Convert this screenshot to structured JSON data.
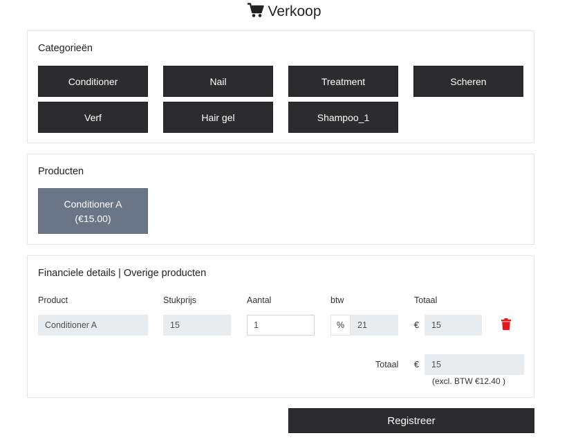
{
  "page": {
    "title": "Verkoop",
    "icon": "shopping-cart-icon"
  },
  "categories": {
    "title": "Categorieën",
    "items": [
      "Conditioner",
      "Nail",
      "Treatment",
      "Scheren",
      "Verf",
      "Hair gel",
      "Shampoo_1"
    ]
  },
  "products": {
    "title": "Producten",
    "items": [
      {
        "name": "Conditioner A",
        "price": "(€15.00)"
      }
    ]
  },
  "financial": {
    "title": "Financiele details | Overige producten",
    "columns": {
      "product": "Product",
      "unit_price": "Stukprijs",
      "quantity": "Aantal",
      "vat": "btw",
      "total": "Totaal"
    },
    "row": {
      "product": "Conditioner A",
      "unit_price": "15",
      "quantity": "1",
      "vat_symbol": "%",
      "vat": "21",
      "currency": "€",
      "total": "15"
    },
    "summary": {
      "label": "Totaal",
      "currency": "€",
      "value": "15",
      "excl_vat": "(excl. BTW €12.40 )"
    }
  },
  "actions": {
    "register_label": "Registreer"
  },
  "colors": {
    "dark_button": "#2c2c2e",
    "product_button": "#6b7588",
    "delete_red": "#e3171c"
  }
}
